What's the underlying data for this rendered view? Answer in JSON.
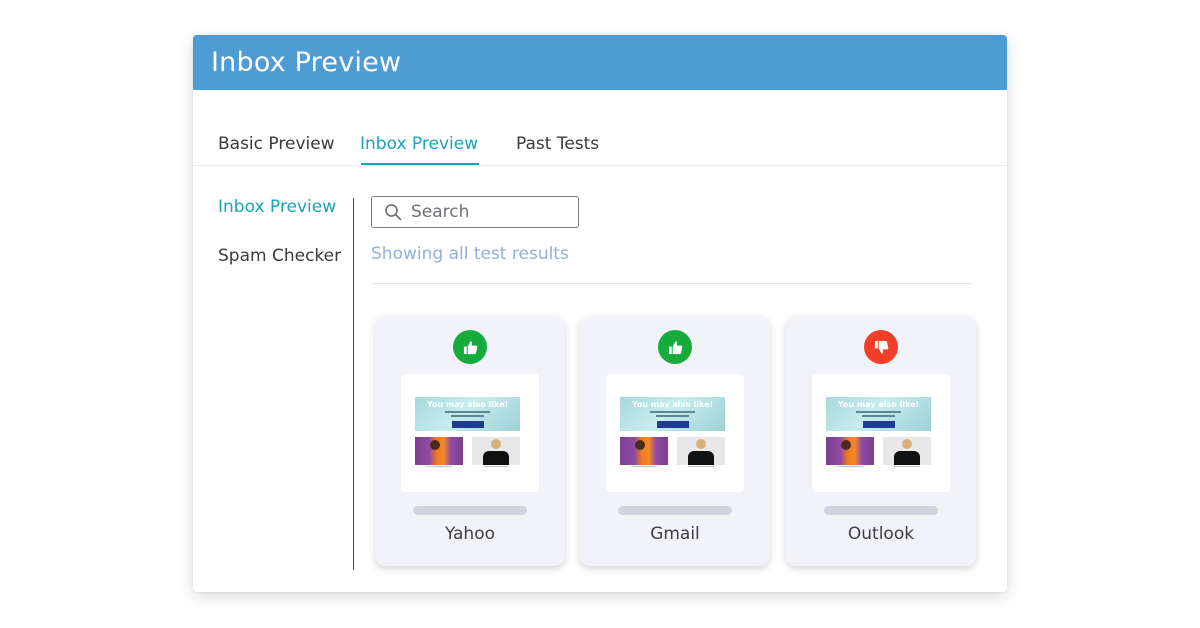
{
  "window": {
    "title": "Inbox Preview"
  },
  "tabs": [
    {
      "label": "Basic Preview",
      "active": false
    },
    {
      "label": "Inbox Preview",
      "active": true
    },
    {
      "label": "Past Tests",
      "active": false
    }
  ],
  "sidebar": {
    "items": [
      {
        "label": "Inbox Preview",
        "active": true
      },
      {
        "label": "Spam Checker",
        "active": false
      }
    ]
  },
  "search": {
    "placeholder": "Search"
  },
  "results_note": "Showing all test results",
  "preview_email": {
    "headline": "You may also like!"
  },
  "clients": [
    {
      "name": "Yahoo",
      "status": "pass",
      "icon": "thumbs-up-icon"
    },
    {
      "name": "Gmail",
      "status": "pass",
      "icon": "thumbs-up-icon"
    },
    {
      "name": "Outlook",
      "status": "fail",
      "icon": "thumbs-down-icon"
    }
  ],
  "colors": {
    "header": "#4f9bd3",
    "accent": "#1aa2b6",
    "pass": "#15ac3d",
    "fail": "#f33e2a",
    "note": "#93aee0"
  }
}
